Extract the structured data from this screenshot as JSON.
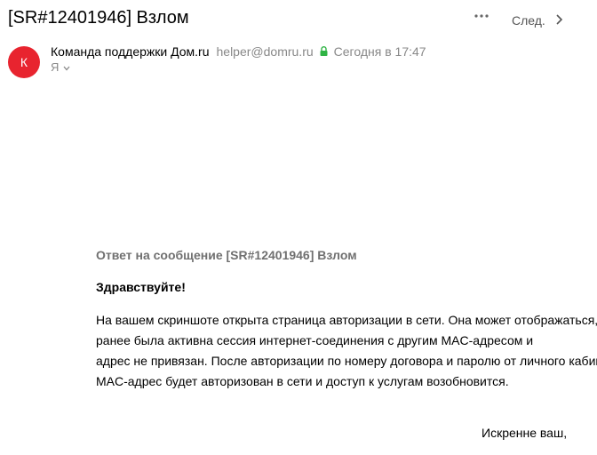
{
  "message": {
    "subject": "[SR#12401946] Взлом",
    "next_label": "След.",
    "sender": {
      "avatar_letter": "К",
      "avatar_color": "#e8242f",
      "name": "Команда поддержки Дом.ru",
      "email": "helper@domru.ru",
      "date": "Сегодня в 17:47"
    },
    "recipient": "Я",
    "body": {
      "heading": "Ответ на сообщение [SR#12401946] Взлом",
      "greeting": "Здравствуйте!",
      "lines": [
        "На вашем скриншоте открыта страница авторизации в сети. Она может отображаться,",
        "ранее была активна сессия интернет-соединения с другим MAC-адресом и",
        "адрес не привязан. После авторизации по номеру договора и паролю от личного кабинета",
        "MAC-адрес будет авторизован в сети и доступ к услугам возобновится."
      ],
      "signoff": "Искренне ваш,"
    }
  },
  "colors": {
    "accent_red": "#e8242f",
    "secure_green": "#2fb344",
    "muted_text": "#888888"
  },
  "icons": {
    "more": "more-dots-icon",
    "next": "chevron-right-icon",
    "secure": "lock-icon",
    "expand": "chevron-down-icon"
  }
}
